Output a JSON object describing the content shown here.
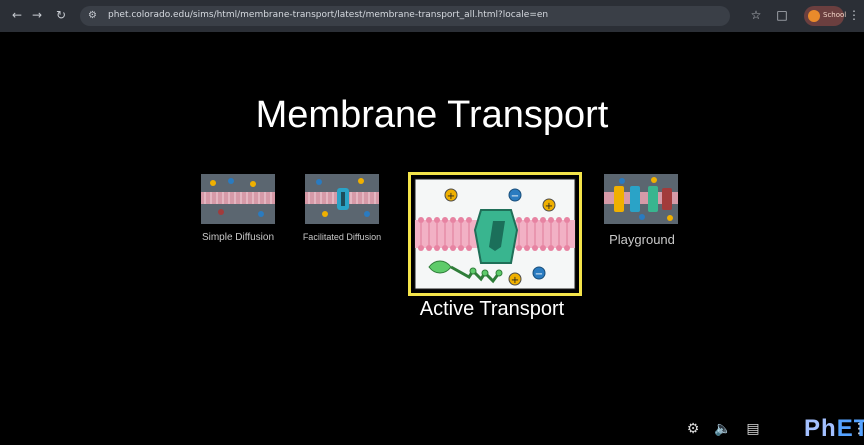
{
  "browser": {
    "url": "phet.colorado.edu/sims/html/membrane-transport/latest/membrane-transport_all.html?locale=en",
    "profile_label": "School"
  },
  "sim": {
    "title": "Membrane Transport",
    "screens": [
      {
        "label": "Simple Diffusion"
      },
      {
        "label": "Facilitated Diffusion"
      },
      {
        "label": "Active Transport"
      },
      {
        "label": "Playground"
      }
    ]
  },
  "footer": {
    "settings_icon": "gear-icon",
    "sound_icon": "speaker-icon",
    "screen_icon": "screen-icon",
    "phet_logo": "PhET"
  },
  "colors": {
    "background": "#000000",
    "highlight": "#f4e44a"
  }
}
